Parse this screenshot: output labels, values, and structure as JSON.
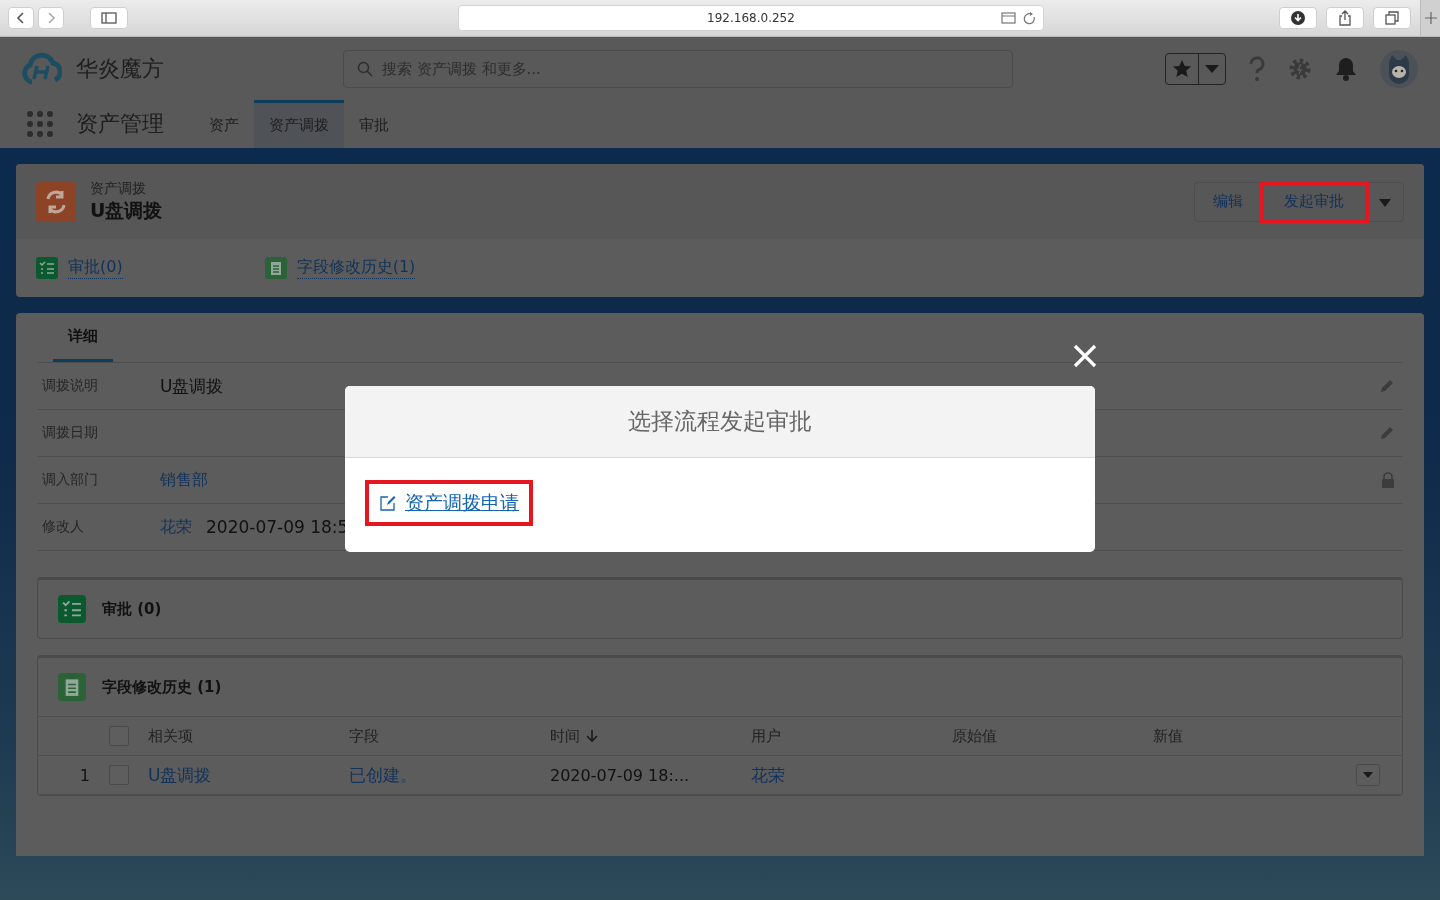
{
  "browser": {
    "url": "192.168.0.252"
  },
  "app": {
    "name": "华炎魔方",
    "search": {
      "placeholder": "搜索 资产调拨 和更多..."
    }
  },
  "nav": {
    "title": "资产管理",
    "tabs": [
      {
        "label": "资产",
        "selected": false
      },
      {
        "label": "资产调拨",
        "selected": true
      },
      {
        "label": "审批",
        "selected": false
      }
    ]
  },
  "record": {
    "type": "资产调拨",
    "name": "U盘调拨",
    "actions": [
      {
        "label": "编辑",
        "highlighted": false
      },
      {
        "label": "发起审批",
        "highlighted": true
      }
    ],
    "related_links": [
      {
        "label": "审批(0)",
        "kind": "approval"
      },
      {
        "label": "字段修改历史(1)",
        "kind": "history"
      }
    ]
  },
  "details": {
    "tabs": [
      {
        "label": "详细",
        "selected": true
      }
    ],
    "fields": [
      {
        "label": "调拨说明",
        "value": "U盘调拨",
        "kind": "editable"
      },
      {
        "label": "调拨日期",
        "kind": "editable"
      },
      {
        "label": "调入部门",
        "link": "销售部",
        "kind": "locked"
      },
      {
        "label": "修改人",
        "link": "花荣",
        "value": "2020-07-09 18:5",
        "kind": "readonly"
      }
    ]
  },
  "related_lists": [
    {
      "title": "审批 (0)",
      "kind": "approval"
    },
    {
      "title": "字段修改历史 (1)",
      "kind": "history",
      "table": {
        "all_checked": false,
        "columns": [
          {
            "label": "相关项",
            "sorted": false
          },
          {
            "label": "字段",
            "sorted": false
          },
          {
            "label": "时间",
            "sorted": true
          },
          {
            "label": "用户",
            "sorted": false
          },
          {
            "label": "原始值",
            "sorted": false
          },
          {
            "label": "新值",
            "sorted": false
          }
        ],
        "rows": [
          {
            "number": "1",
            "checked": false,
            "cells": [
              {
                "text": "U盘调拨",
                "link": true
              },
              {
                "text": "已创建。",
                "link": true
              },
              {
                "text": "2020-07-09 18:...",
                "link": false
              },
              {
                "text": "花荣",
                "link": true
              }
            ]
          }
        ]
      }
    }
  ],
  "modal": {
    "title": "选择流程发起审批",
    "options": [
      {
        "label": "资产调拨申请",
        "highlighted": true
      }
    ]
  }
}
